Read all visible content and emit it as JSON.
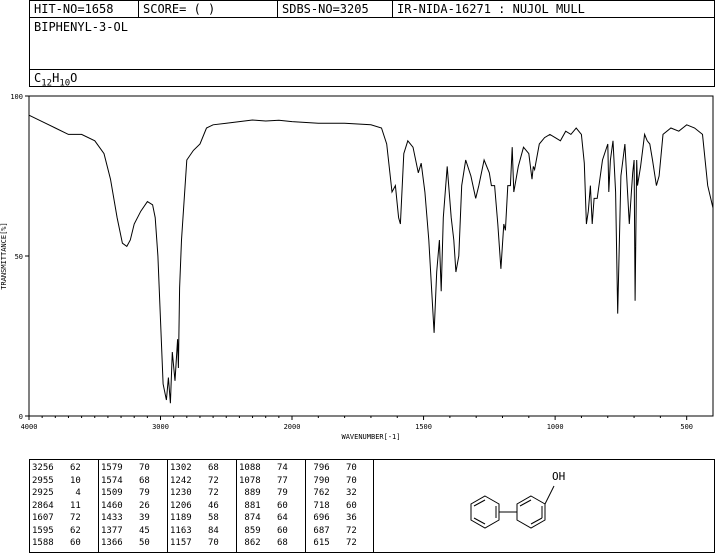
{
  "header": {
    "hit_no": "HIT-NO=1658",
    "score": "SCORE=  (   )",
    "sdbs_no": "SDBS-NO=3205",
    "ir_id": "IR-NIDA-16271 : NUJOL MULL"
  },
  "compound": {
    "name": "BIPHENYL-3-OL",
    "formula_c": "C",
    "formula_c_sub": "12",
    "formula_h": "H",
    "formula_h_sub": "10",
    "formula_o": "O"
  },
  "chart_data": {
    "type": "line",
    "xlabel": "WAVENUMBER[-1]",
    "ylabel": "TRANSMITTANCE[%]",
    "xlim": [
      4000,
      400
    ],
    "ylim": [
      0,
      100
    ],
    "x_ticks": [
      4000,
      3000,
      2000,
      1500,
      1000,
      500
    ],
    "y_ticks": [
      0,
      50,
      100
    ],
    "x": [
      4000,
      3900,
      3800,
      3700,
      3600,
      3500,
      3430,
      3380,
      3330,
      3290,
      3256,
      3230,
      3200,
      3150,
      3100,
      3060,
      3040,
      3020,
      3000,
      2980,
      2955,
      2940,
      2925,
      2910,
      2890,
      2870,
      2864,
      2855,
      2840,
      2800,
      2750,
      2700,
      2650,
      2600,
      2500,
      2400,
      2300,
      2200,
      2100,
      2000,
      1900,
      1800,
      1700,
      1660,
      1640,
      1620,
      1607,
      1600,
      1595,
      1588,
      1575,
      1560,
      1540,
      1520,
      1509,
      1495,
      1480,
      1460,
      1450,
      1440,
      1433,
      1425,
      1410,
      1395,
      1385,
      1377,
      1366,
      1355,
      1340,
      1320,
      1302,
      1290,
      1270,
      1250,
      1242,
      1230,
      1218,
      1206,
      1195,
      1189,
      1180,
      1170,
      1163,
      1157,
      1140,
      1120,
      1100,
      1088,
      1083,
      1078,
      1060,
      1040,
      1020,
      1000,
      980,
      960,
      940,
      920,
      900,
      889,
      881,
      874,
      866,
      859,
      852,
      840,
      820,
      800,
      796,
      790,
      780,
      770,
      762,
      750,
      735,
      718,
      710,
      705,
      700,
      696,
      690,
      687,
      675,
      660,
      650,
      640,
      630,
      615,
      605,
      590,
      560,
      530,
      500,
      470,
      440,
      420,
      400
    ],
    "y": [
      94,
      92,
      90,
      88,
      88,
      86,
      82,
      74,
      62,
      54,
      53,
      55,
      60,
      64,
      67,
      66,
      62,
      50,
      30,
      10,
      5,
      12,
      4,
      20,
      11,
      24,
      15,
      40,
      55,
      80,
      83,
      85,
      90,
      91,
      91.5,
      92,
      92.5,
      92.2,
      92.4,
      92,
      91.5,
      91.5,
      91,
      90,
      85,
      70,
      72,
      66,
      62,
      60,
      82,
      86,
      84,
      76,
      79,
      70,
      55,
      26,
      45,
      55,
      39,
      62,
      78,
      62,
      55,
      45,
      50,
      72,
      80,
      75,
      68,
      72,
      80,
      76,
      72,
      72,
      60,
      46,
      60,
      58,
      72,
      72,
      84,
      70,
      78,
      84,
      82,
      74,
      78,
      77,
      85,
      87,
      88,
      87,
      86,
      89,
      88,
      90,
      88,
      79,
      60,
      64,
      72,
      60,
      68,
      68,
      80,
      85,
      70,
      80,
      86,
      70,
      32,
      75,
      85,
      60,
      70,
      76,
      80,
      36,
      80,
      72,
      78,
      88,
      86,
      85,
      80,
      72,
      75,
      88,
      90,
      89,
      91,
      90,
      88,
      72,
      65
    ]
  },
  "peak_table": {
    "columns": [
      [
        [
          "3256",
          "62"
        ],
        [
          "2955",
          "10"
        ],
        [
          "2925",
          "4"
        ],
        [
          "2864",
          "11"
        ],
        [
          "1607",
          "72"
        ],
        [
          "1595",
          "62"
        ],
        [
          "1588",
          "60"
        ]
      ],
      [
        [
          "1579",
          "70"
        ],
        [
          "1574",
          "68"
        ],
        [
          "1509",
          "79"
        ],
        [
          "1460",
          "26"
        ],
        [
          "1433",
          "39"
        ],
        [
          "1377",
          "45"
        ],
        [
          "1366",
          "50"
        ]
      ],
      [
        [
          "1302",
          "68"
        ],
        [
          "1242",
          "72"
        ],
        [
          "1230",
          "72"
        ],
        [
          "1206",
          "46"
        ],
        [
          "1189",
          "58"
        ],
        [
          "1163",
          "84"
        ],
        [
          "1157",
          "70"
        ]
      ],
      [
        [
          "1088",
          "74"
        ],
        [
          "1078",
          "77"
        ],
        [
          "889",
          "79"
        ],
        [
          "881",
          "60"
        ],
        [
          "874",
          "64"
        ],
        [
          "859",
          "60"
        ],
        [
          "862",
          "68"
        ]
      ],
      [
        [
          "796",
          "70"
        ],
        [
          "790",
          "70"
        ],
        [
          "762",
          "32"
        ],
        [
          "718",
          "60"
        ],
        [
          "696",
          "36"
        ],
        [
          "687",
          "72"
        ],
        [
          "615",
          "72"
        ]
      ]
    ]
  },
  "structure": {
    "label": "OH"
  }
}
